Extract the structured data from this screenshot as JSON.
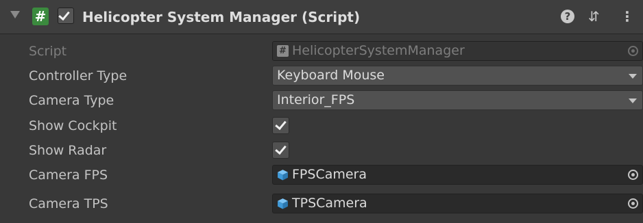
{
  "header": {
    "title": "Helicopter System Manager (Script)",
    "enabled": true,
    "script_icon": "#",
    "icons": [
      "foldout-arrow-icon",
      "script-icon",
      "help-icon",
      "preset-icon",
      "kebab-menu-icon"
    ]
  },
  "fields": {
    "script": {
      "label": "Script",
      "value": "HelicopterSystemManager"
    },
    "controller_type": {
      "label": "Controller Type",
      "value": "Keyboard Mouse"
    },
    "camera_type": {
      "label": "Camera Type",
      "value": "Interior_FPS"
    },
    "show_cockpit": {
      "label": "Show Cockpit",
      "checked": true
    },
    "show_radar": {
      "label": "Show Radar",
      "checked": true
    },
    "camera_fps": {
      "label": "Camera FPS",
      "value": "FPSCamera"
    },
    "camera_tps": {
      "label": "Camera TPS",
      "value": "TPSCamera"
    }
  },
  "colors": {
    "background": "#383838",
    "header": "#3e3e3e",
    "script_badge": "#3b8a3e",
    "gameobject_icon": "#4aa9e8"
  }
}
